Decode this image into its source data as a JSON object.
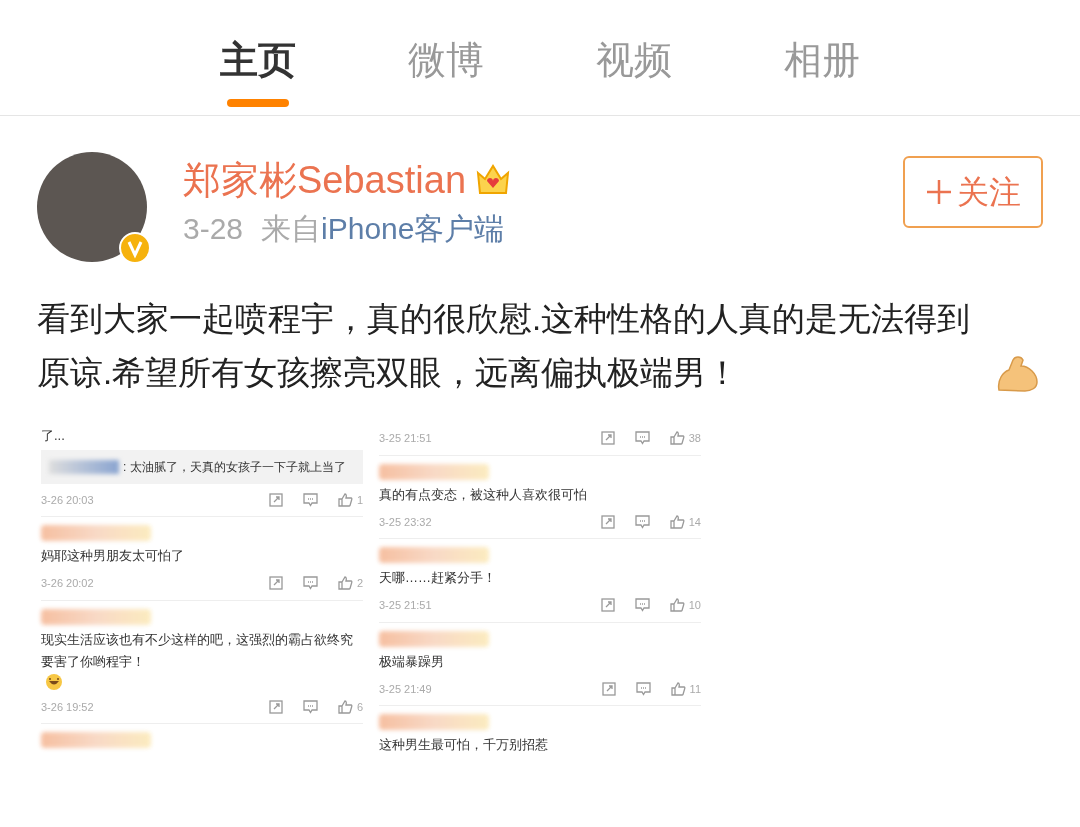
{
  "tabs": [
    {
      "label": "主页",
      "selected": true
    },
    {
      "label": "微博",
      "selected": false
    },
    {
      "label": "视频",
      "selected": false
    },
    {
      "label": "相册",
      "selected": false
    }
  ],
  "post": {
    "author": "郑家彬Sebastian",
    "date": "3-28",
    "source_prefix": "来自",
    "source": "iPhone客户端",
    "follow_label": "关注",
    "text": "看到大家一起喷程宇，真的很欣慰.这种性格的人真的是无法得到原谅.希望所有女孩擦亮双眼，远离偏执极端男！"
  },
  "comment_columns": [
    [
      {
        "kind": "text",
        "text": "了..."
      },
      {
        "kind": "quote",
        "text": ": 太油腻了，天真的女孩子一下子就上当了"
      },
      {
        "kind": "meta",
        "time": "3-26 20:03",
        "likes": "1"
      },
      {
        "kind": "comment",
        "text": "妈耶这种男朋友太可怕了",
        "emoji": false
      },
      {
        "kind": "meta",
        "time": "3-26 20:02",
        "likes": "2"
      },
      {
        "kind": "comment",
        "text": "现实生活应该也有不少这样的吧，这强烈的霸占欲终究要害了你哟程宇！",
        "emoji": true
      },
      {
        "kind": "meta",
        "time": "3-26 19:52",
        "likes": "6"
      },
      {
        "kind": "name"
      }
    ],
    [
      {
        "kind": "meta",
        "time": "3-25 21:51",
        "likes": "38"
      },
      {
        "kind": "comment",
        "text": "真的有点变态，被这种人喜欢很可怕",
        "emoji": false
      },
      {
        "kind": "meta",
        "time": "3-25 23:32",
        "likes": "14"
      },
      {
        "kind": "comment",
        "text": "天哪……赶紧分手！",
        "emoji": false
      },
      {
        "kind": "meta",
        "time": "3-25 21:51",
        "likes": "10"
      },
      {
        "kind": "comment",
        "text": "极端暴躁男",
        "emoji": false
      },
      {
        "kind": "meta",
        "time": "3-25 21:49",
        "likes": "11"
      },
      {
        "kind": "comment",
        "text": "这种男生最可怕，千万别招惹",
        "emoji": false
      }
    ]
  ]
}
